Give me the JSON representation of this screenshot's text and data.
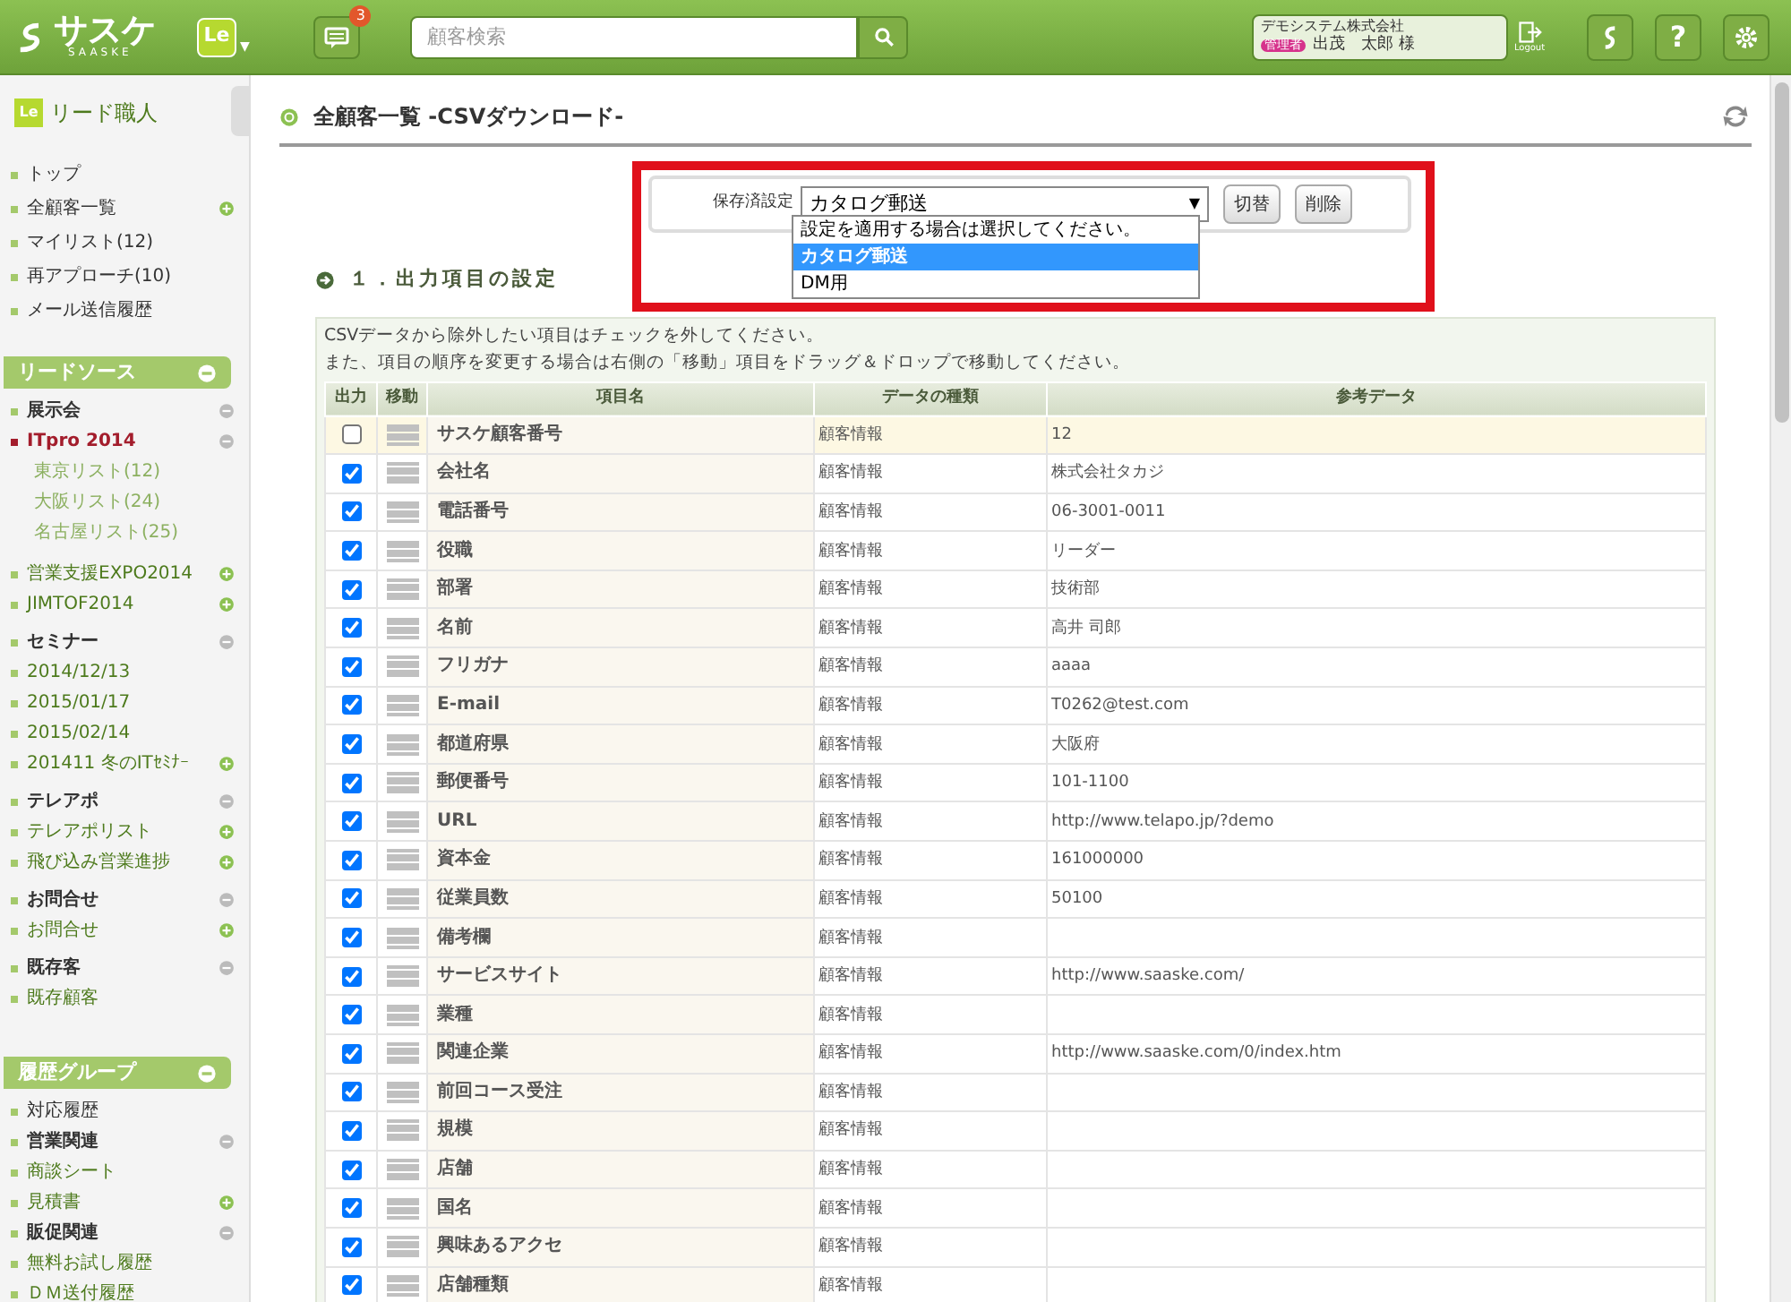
{
  "header": {
    "logo": "サスケ",
    "logo_sub": "SAASKE",
    "app_badge": "Le",
    "app_caret": "▼",
    "notifications": "3",
    "search": {
      "placeholder": "顧客検索"
    },
    "company": "デモシステム株式会社",
    "role": "管理者",
    "user": "出茂　太郎 様",
    "logout": "Logout",
    "help": "?"
  },
  "sidebar": {
    "app_icon": "Le",
    "title": "リード職人",
    "top_items": [
      {
        "label": "トップ",
        "add": false
      },
      {
        "label": "全顧客一覧",
        "add": true
      },
      {
        "label": "マイリスト(12)",
        "add": false
      },
      {
        "label": "再アプローチ(10)",
        "add": false
      },
      {
        "label": "メール送信履歴",
        "add": false
      }
    ],
    "sections": [
      {
        "title": "リードソース",
        "groups": [
          {
            "label": "展示会",
            "items": [
              {
                "label": "ITpro 2014",
                "selected": true,
                "expanded": true,
                "add": false,
                "children": [
                  {
                    "label": "東京リスト(12)"
                  },
                  {
                    "label": "大阪リスト(24)"
                  },
                  {
                    "label": "名古屋リスト(25)"
                  }
                ]
              },
              {
                "label": "営業支援EXPO2014",
                "selected": false,
                "expanded": false,
                "add": true
              },
              {
                "label": "JIMTOF2014",
                "selected": false,
                "expanded": false,
                "add": true
              }
            ]
          },
          {
            "label": "セミナー",
            "items": [
              {
                "label": "2014/12/13",
                "selected": false,
                "expanded": false,
                "add": false
              },
              {
                "label": "2015/01/17",
                "selected": false,
                "expanded": false,
                "add": false
              },
              {
                "label": "2015/02/14",
                "selected": false,
                "expanded": false,
                "add": false
              },
              {
                "label": "201411 冬のITｾﾐﾅｰ",
                "selected": false,
                "expanded": false,
                "add": true
              }
            ]
          },
          {
            "label": "テレアポ",
            "items": [
              {
                "label": "テレアポリスト",
                "selected": false,
                "expanded": false,
                "add": true
              },
              {
                "label": "飛び込み営業進捗",
                "selected": false,
                "expanded": false,
                "add": true
              }
            ]
          },
          {
            "label": "お問合せ",
            "items": [
              {
                "label": "お問合せ",
                "selected": false,
                "expanded": false,
                "add": true
              }
            ]
          },
          {
            "label": "既存客",
            "items": [
              {
                "label": "既存顧客",
                "selected": false,
                "expanded": false,
                "add": false
              }
            ]
          }
        ]
      },
      {
        "title": "履歴グループ",
        "groups": [
          {
            "label": "対応履歴",
            "kind": "link"
          },
          {
            "label": "営業関連",
            "items": [
              {
                "label": "商談シート",
                "selected": false,
                "expanded": false,
                "add": false
              },
              {
                "label": "見積書",
                "selected": false,
                "expanded": false,
                "add": true
              }
            ]
          },
          {
            "label": "販促関連",
            "items": [
              {
                "label": "無料お試し履歴",
                "selected": false,
                "expanded": false,
                "add": false
              },
              {
                "label": "ＤＭ送付履歴",
                "selected": false,
                "expanded": false,
                "add": false
              }
            ]
          }
        ]
      }
    ]
  },
  "page": {
    "title": "全顧客一覧 -CSVダウンロード-",
    "saved": {
      "label": "保存済設定",
      "value": "カタログ郵送",
      "arrow": "▼",
      "buttons": [
        "切替",
        "削除"
      ],
      "options": [
        {
          "label": "設定を適用する場合は選択してください。",
          "selected": false
        },
        {
          "label": "カタログ郵送",
          "selected": true
        },
        {
          "label": "DM用",
          "selected": false
        }
      ]
    },
    "section_title": "１．出力項目の設定",
    "notes": [
      "CSVデータから除外したい項目はチェックを外してください。",
      "また、項目の順序を変更する場合は右側の「移動」項目をドラッグ＆ドロップで移動してください。"
    ],
    "table": {
      "columns": [
        "出力",
        "移動",
        "項目名",
        "データの種類",
        "参考データ"
      ],
      "rows": [
        {
          "checked": false,
          "name": "サスケ顧客番号",
          "type": "顧客情報",
          "sample": "12"
        },
        {
          "checked": true,
          "name": "会社名",
          "type": "顧客情報",
          "sample": "株式会社タカジ"
        },
        {
          "checked": true,
          "name": "電話番号",
          "type": "顧客情報",
          "sample": "06-3001-0011"
        },
        {
          "checked": true,
          "name": "役職",
          "type": "顧客情報",
          "sample": "リーダー"
        },
        {
          "checked": true,
          "name": "部署",
          "type": "顧客情報",
          "sample": "技術部"
        },
        {
          "checked": true,
          "name": "名前",
          "type": "顧客情報",
          "sample": "高井 司郎"
        },
        {
          "checked": true,
          "name": "フリガナ",
          "type": "顧客情報",
          "sample": "aaaa"
        },
        {
          "checked": true,
          "name": "E-mail",
          "type": "顧客情報",
          "sample": "T0262@test.com"
        },
        {
          "checked": true,
          "name": "都道府県",
          "type": "顧客情報",
          "sample": "大阪府"
        },
        {
          "checked": true,
          "name": "郵便番号",
          "type": "顧客情報",
          "sample": "101-1100"
        },
        {
          "checked": true,
          "name": "URL",
          "type": "顧客情報",
          "sample": "http://www.telapo.jp/?demo"
        },
        {
          "checked": true,
          "name": "資本金",
          "type": "顧客情報",
          "sample": "161000000"
        },
        {
          "checked": true,
          "name": "従業員数",
          "type": "顧客情報",
          "sample": "50100"
        },
        {
          "checked": true,
          "name": "備考欄",
          "type": "顧客情報"
        },
        {
          "checked": true,
          "name": "サービスサイト",
          "type": "顧客情報",
          "sample": "http://www.saaske.com/"
        },
        {
          "checked": true,
          "name": "業種",
          "type": "顧客情報"
        },
        {
          "checked": true,
          "name": "関連企業",
          "type": "顧客情報",
          "sample": "http://www.saaske.com/0/index.htm"
        },
        {
          "checked": true,
          "name": "前回コース受注",
          "type": "顧客情報"
        },
        {
          "checked": true,
          "name": "規模",
          "type": "顧客情報"
        },
        {
          "checked": true,
          "name": "店舗",
          "type": "顧客情報"
        },
        {
          "checked": true,
          "name": "国名",
          "type": "顧客情報"
        },
        {
          "checked": true,
          "name": "興味あるアクセ",
          "type": "顧客情報"
        },
        {
          "checked": true,
          "name": "店舗種類",
          "type": "顧客情報"
        }
      ]
    }
  }
}
